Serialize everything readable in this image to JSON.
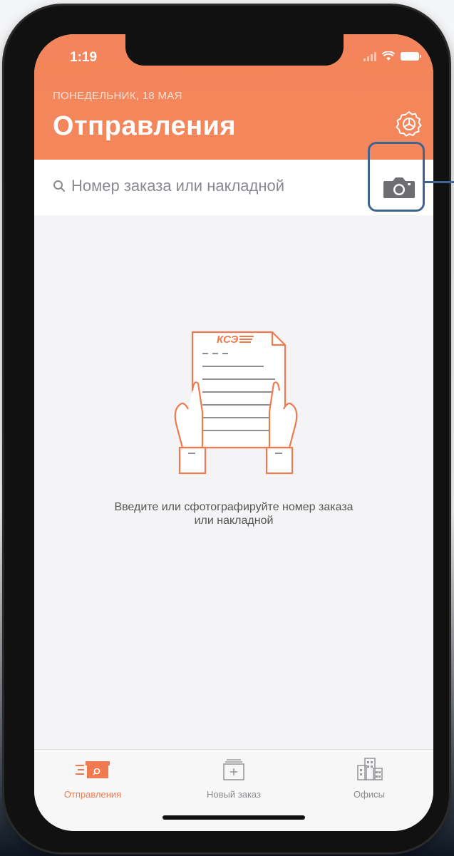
{
  "status_bar": {
    "time": "1:19"
  },
  "header": {
    "date": "ПОНЕДЕЛЬНИК, 18 МАЯ",
    "title": "Отправления",
    "settings_icon": "gear-icon"
  },
  "search": {
    "placeholder": "Номер заказа или накладной",
    "camera_icon": "camera-icon"
  },
  "empty_state": {
    "logo_text": "КСЭ",
    "line1": "Введите или сфотографируйте номер заказа",
    "line2": "или накладной"
  },
  "tabs": [
    {
      "label": "Отправления",
      "icon": "parcel-search-icon",
      "active": true
    },
    {
      "label": "Новый заказ",
      "icon": "new-box-icon",
      "active": false
    },
    {
      "label": "Офисы",
      "icon": "buildings-icon",
      "active": false
    }
  ],
  "colors": {
    "accent": "#f4845b",
    "highlight_frame": "#3e6491"
  }
}
